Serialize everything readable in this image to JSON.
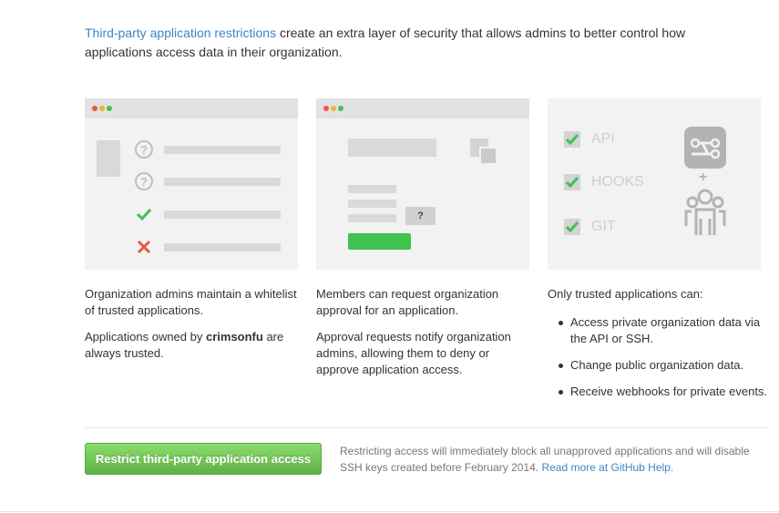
{
  "intro": {
    "link_text": "Third-party application restrictions",
    "text": " create an extra layer of security that allows admins to better control how applications access data in their organization."
  },
  "illustration3": {
    "checks": [
      "API",
      "HOOKS",
      "GIT"
    ],
    "plus": "+"
  },
  "illustration2": {
    "question": "?"
  },
  "column1": {
    "para1": "Organization admins maintain a whitelist of trusted applications.",
    "para2_prefix": "Applications owned by ",
    "org_name": "crimsonfu",
    "para2_suffix": " are always trusted."
  },
  "column2": {
    "para1": "Members can request organization approval for an application.",
    "para2": "Approval requests notify organization admins, allowing them to deny or approve application access."
  },
  "column3": {
    "intro": "Only trusted applications can:",
    "items": [
      "Access private organization data via the API or SSH.",
      "Change public organization data.",
      "Receive webhooks for private events."
    ]
  },
  "action": {
    "button_label": "Restrict third-party application access",
    "note_text": "Restricting access will immediately block all unapproved applications and will disable SSH keys created before February 2014. ",
    "help_link": "Read more at GitHub Help."
  },
  "colors": {
    "link": "#4183c4",
    "button_green": "#60b044",
    "check_green": "#3fc24f",
    "cross_red": "#e9574c"
  }
}
